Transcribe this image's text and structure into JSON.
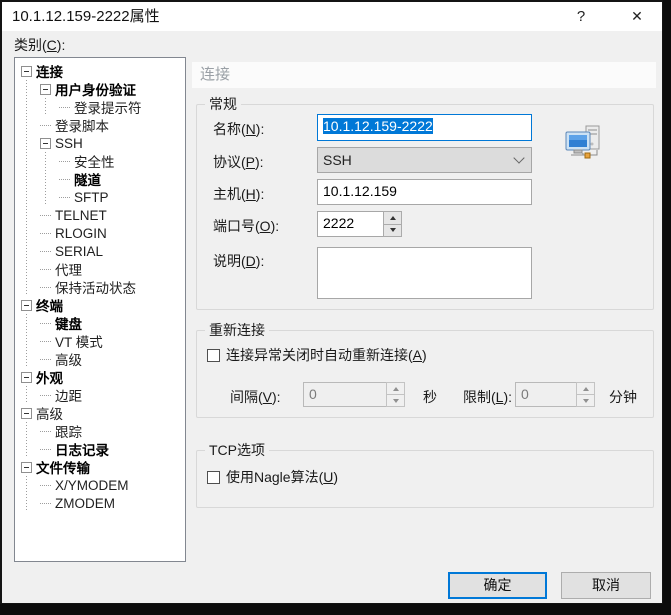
{
  "window": {
    "title": "10.1.12.159-2222属性",
    "help_button": "?",
    "close_button": "✕"
  },
  "category": {
    "pre": "类别(",
    "key": "C",
    "suf": "):"
  },
  "tree": {
    "items": [
      {
        "label": "连接",
        "level": 0,
        "bold": true,
        "expand": true
      },
      {
        "label": "用户身份验证",
        "level": 1,
        "bold": true,
        "expand": true
      },
      {
        "label": "登录提示符",
        "level": 2,
        "bold": false,
        "expand": false
      },
      {
        "label": "登录脚本",
        "level": 1,
        "bold": false,
        "expand": false
      },
      {
        "label": "SSH",
        "level": 1,
        "bold": false,
        "expand": true
      },
      {
        "label": "安全性",
        "level": 2,
        "bold": false,
        "expand": false
      },
      {
        "label": "隧道",
        "level": 2,
        "bold": true,
        "expand": false
      },
      {
        "label": "SFTP",
        "level": 2,
        "bold": false,
        "expand": false
      },
      {
        "label": "TELNET",
        "level": 1,
        "bold": false,
        "expand": false
      },
      {
        "label": "RLOGIN",
        "level": 1,
        "bold": false,
        "expand": false
      },
      {
        "label": "SERIAL",
        "level": 1,
        "bold": false,
        "expand": false
      },
      {
        "label": "代理",
        "level": 1,
        "bold": false,
        "expand": false
      },
      {
        "label": "保持活动状态",
        "level": 1,
        "bold": false,
        "expand": false
      },
      {
        "label": "终端",
        "level": 0,
        "bold": true,
        "expand": true
      },
      {
        "label": "键盘",
        "level": 1,
        "bold": true,
        "expand": false
      },
      {
        "label": "VT 模式",
        "level": 1,
        "bold": false,
        "expand": false
      },
      {
        "label": "高级",
        "level": 1,
        "bold": false,
        "expand": false
      },
      {
        "label": "外观",
        "level": 0,
        "bold": true,
        "expand": true
      },
      {
        "label": "边距",
        "level": 1,
        "bold": false,
        "expand": false
      },
      {
        "label": "高级",
        "level": 0,
        "bold": false,
        "expand": true
      },
      {
        "label": "跟踪",
        "level": 1,
        "bold": false,
        "expand": false
      },
      {
        "label": "日志记录",
        "level": 1,
        "bold": true,
        "expand": false
      },
      {
        "label": "文件传输",
        "level": 0,
        "bold": true,
        "expand": true
      },
      {
        "label": "X/YMODEM",
        "level": 1,
        "bold": false,
        "expand": false
      },
      {
        "label": "ZMODEM",
        "level": 1,
        "bold": false,
        "expand": false
      }
    ]
  },
  "panel": {
    "header": "连接",
    "general": {
      "title": "常规",
      "name_label": {
        "pre": "名称(",
        "key": "N",
        "suf": "):"
      },
      "name_value": "10.1.12.159-2222",
      "protocol_label": {
        "pre": "协议(",
        "key": "P",
        "suf": "):"
      },
      "protocol_value": "SSH",
      "host_label": {
        "pre": "主机(",
        "key": "H",
        "suf": "):"
      },
      "host_value": "10.1.12.159",
      "port_label": {
        "pre": "端口号(",
        "key": "O",
        "suf": "):"
      },
      "port_value": "2222",
      "desc_label": {
        "pre": "说明(",
        "key": "D",
        "suf": "):"
      },
      "desc_value": ""
    },
    "reconnect": {
      "title": "重新连接",
      "auto_reconnect_label": {
        "pre": "连接异常关闭时自动重新连接(",
        "key": "A",
        "suf": ")"
      },
      "auto_reconnect_checked": false,
      "interval_label": {
        "pre": "间隔(",
        "key": "V",
        "suf": "):"
      },
      "interval_value": "0",
      "interval_unit": "秒",
      "limit_label": {
        "pre": "限制(",
        "key": "L",
        "suf": "):"
      },
      "limit_value": "0",
      "limit_unit": "分钟"
    },
    "tcp": {
      "title": "TCP选项",
      "nagle_label": {
        "pre": "使用Nagle算法(",
        "key": "U",
        "suf": ")"
      },
      "nagle_checked": false
    }
  },
  "buttons": {
    "ok": "确定",
    "cancel": "取消"
  },
  "colors": {
    "accent": "#0078d7",
    "selection_bg": "#0078d7",
    "selection_fg": "#ffffff",
    "dialog_bg": "#f0f0f0",
    "titlebar_bg": "#ffffff"
  }
}
